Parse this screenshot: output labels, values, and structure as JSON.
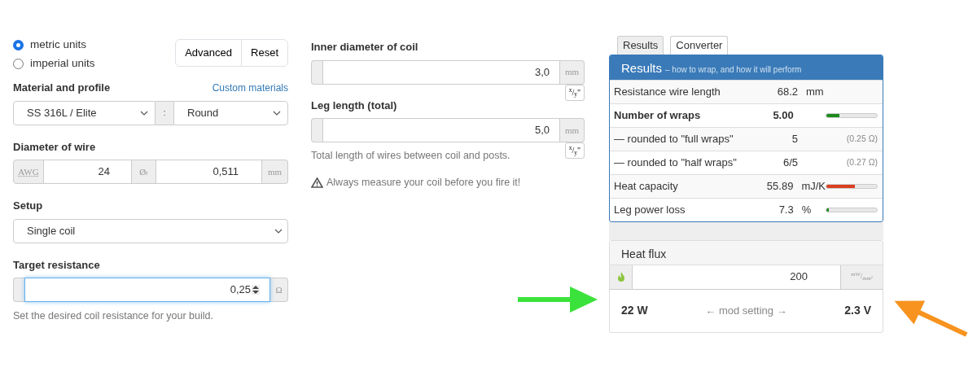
{
  "units": [
    {
      "label": "metric units",
      "selected": true
    },
    {
      "label": "imperial units",
      "selected": false
    }
  ],
  "buttons": [
    "Advanced",
    "Reset"
  ],
  "material": {
    "label": "Material and profile",
    "link": "Custom materials",
    "material_value": "SS 316L / Elite",
    "separator": ":",
    "profile_value": "Round"
  },
  "wire": {
    "label": "Diameter of wire",
    "awg_addon": "AWG",
    "awg_value": "24",
    "diameter_addon": "Ø$_{r}$",
    "diameter_value": "0,511",
    "unit": "mm"
  },
  "setup": {
    "label": "Setup",
    "value": "Single coil"
  },
  "target": {
    "label": "Target resistance",
    "value": "0,25",
    "unit": "Ω",
    "help": "Set the desired coil resistance for your build.",
    "focused": true
  },
  "inner": {
    "label": "Inner diameter of coil",
    "value": "3,0",
    "unit": "mm",
    "toggle": "$^{x}$/$_{y}$\""
  },
  "leg": {
    "label": "Leg length (total)",
    "value": "5,0",
    "unit": "mm",
    "help": "Total length of wires between coil and posts.",
    "toggle": "$^{x}$/$_{y}$\""
  },
  "warning": "Always measure your coil before you fire it!",
  "tabs": [
    {
      "label": "Results",
      "selected": true
    },
    {
      "label": "Converter",
      "selected": false
    }
  ],
  "results": {
    "title": "Results",
    "subtitle": "– how to wrap, and how it will perform",
    "rows": [
      {
        "label": "Resistance wire length",
        "value": "68.2",
        "unit": "mm",
        "bold": false
      },
      {
        "label": "Number of wraps",
        "value": "5.00",
        "bold": true,
        "level": 0.25,
        "color": "#1e8a1e"
      },
      {
        "label": "— rounded to \"full wraps\"",
        "value": "5",
        "note": "(0.25 Ω)",
        "bold": false
      },
      {
        "label": "— rounded to \"half wraps\"",
        "value": "6/5",
        "note": "(0.27 Ω)",
        "bold": false
      },
      {
        "label": "Heat capacity",
        "value": "55.89",
        "unit": "mJ/K",
        "bold": false,
        "level": 0.56,
        "color": "#d9401f"
      },
      {
        "label": "Leg power loss",
        "value": "7.3",
        "unit": "%",
        "bold": false,
        "level": 0.05,
        "color": "#1e8a1e"
      }
    ]
  },
  "heat_flux": {
    "title": "Heat flux",
    "value": "200",
    "unit": "$^{mW}$/$_{mm²}$",
    "power": "22 W",
    "middle": "← mod setting →",
    "voltage": "2.3 V"
  },
  "arrows": [
    {
      "color": "#3be23b"
    },
    {
      "color": "#f7931e"
    }
  ]
}
